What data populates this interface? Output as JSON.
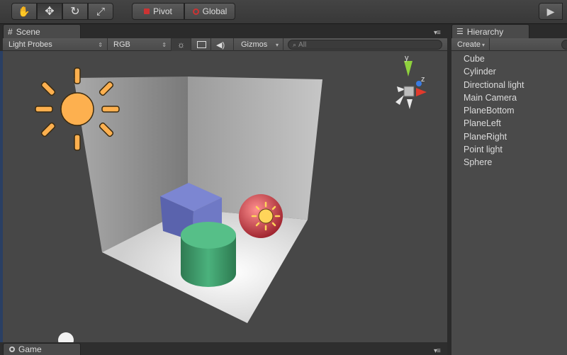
{
  "toolbar": {
    "tools": [
      {
        "name": "hand-tool",
        "glyph": "✋"
      },
      {
        "name": "move-tool",
        "glyph": "✥"
      },
      {
        "name": "rotate-tool",
        "glyph": "↻"
      },
      {
        "name": "scale-tool",
        "glyph": "⤢"
      }
    ],
    "pivot_label": "Pivot",
    "global_label": "Global",
    "play_glyph": "▶"
  },
  "scene": {
    "tab_label": "Scene",
    "draw_mode": "Light Probes",
    "render_mode": "RGB",
    "gizmos_label": "Gizmos",
    "search_placeholder": "All",
    "axis_y": "y",
    "axis_z": "z"
  },
  "game": {
    "tab_label": "Game"
  },
  "hierarchy": {
    "tab_label": "Hierarchy",
    "create_label": "Create",
    "items": [
      "Cube",
      "Cylinder",
      "Directional light",
      "Main Camera",
      "PlaneBottom",
      "PlaneLeft",
      "PlaneRight",
      "Point light",
      "Sphere"
    ]
  },
  "colors": {
    "sun": "#fdb04f",
    "cube": "#6f79c5",
    "cylinder": "#3fa26e",
    "sphere": "#c0343f",
    "axis_x": "#e23a2c",
    "axis_y": "#8fd23d",
    "axis_z": "#3a7be2"
  }
}
